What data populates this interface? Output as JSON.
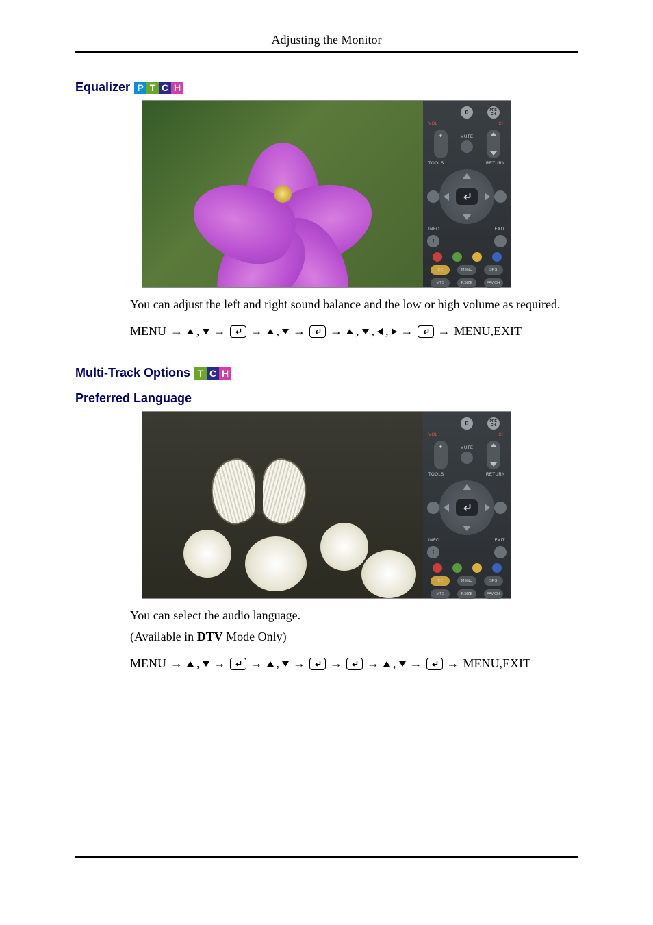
{
  "header": {
    "title": "Adjusting the Monitor"
  },
  "sections": {
    "equalizer": {
      "heading": "Equalizer",
      "badges": [
        "P",
        "T",
        "C",
        "H"
      ],
      "body1": "You can adjust the left and right sound balance and the low or high volume as required.",
      "nav_prefix": "MENU",
      "nav_suffix": "MENU,EXIT"
    },
    "multitrack": {
      "heading": "Multi-Track Options",
      "badges": [
        "T",
        "C",
        "H"
      ],
      "sub_heading": "Preferred Language",
      "body1": "You can select the audio language.",
      "body2_pre": "(Available in ",
      "body2_bold": "DTV",
      "body2_post": " Mode Only)",
      "nav_prefix": "MENU",
      "nav_suffix": "MENU,EXIT"
    }
  },
  "remote": {
    "power_label": "0",
    "prech_label": "PRE\nCH",
    "vol_label": "VOL",
    "ch_label": "CH",
    "mute_label": "MUTE",
    "tools_label": "TOOLS",
    "return_label": "RETURN",
    "info_label": "INFO",
    "exit_label": "EXIT",
    "cc_label": "CC",
    "menu_label": "MENU",
    "srs_label": "SRS",
    "mts_label": "MTS",
    "psize_label": "P.SIZE",
    "favch_label": "FAV.CH"
  },
  "chart_data": {
    "type": "table",
    "description": "UI manual page with two instructional sections (Equalizer and Multi-Track Options > Preferred Language), each paired with the same schematic TV remote. Navigation key sequences shown below each section.",
    "nav_sequences": {
      "equalizer": [
        "MENU",
        "▲,▼",
        "ENTER",
        "▲,▼",
        "ENTER",
        "▲,▼,◀,▶",
        "ENTER",
        "MENU,EXIT"
      ],
      "preferred_language": [
        "MENU",
        "▲,▼",
        "ENTER",
        "▲,▼",
        "ENTER",
        "ENTER",
        "▲,▼",
        "ENTER",
        "MENU,EXIT"
      ]
    }
  }
}
